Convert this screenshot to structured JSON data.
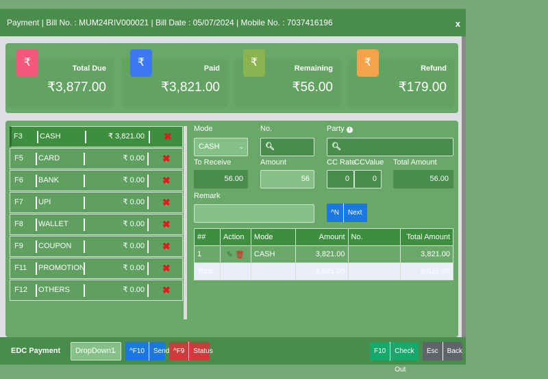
{
  "header": {
    "title": "Payment | Bill No. : MUM24RIV000021 | Bill Date : 05/07/2024 | Mobile No. : 7037416196",
    "close": "x"
  },
  "summary": [
    {
      "label": "Total Due",
      "value": "₹3,877.00",
      "icon": "rupee-icon",
      "color": "#f4587a"
    },
    {
      "label": "Paid",
      "value": "₹3,821.00",
      "icon": "rupee-icon",
      "color": "#3c78f0"
    },
    {
      "label": "Remaining",
      "value": "₹56.00",
      "icon": "rupee-icon",
      "color": "#8ab24e"
    },
    {
      "label": "Refund",
      "value": "₹179.00",
      "icon": "rupee-icon",
      "color": "#f5a34a"
    }
  ],
  "modes": [
    {
      "key": "F3",
      "name": "CASH",
      "amount": "₹ 3,821.00",
      "active": true
    },
    {
      "key": "F5",
      "name": "CARD",
      "amount": "₹ 0.00"
    },
    {
      "key": "F6",
      "name": "BANK",
      "amount": "₹ 0.00"
    },
    {
      "key": "F7",
      "name": "UPI",
      "amount": "₹ 0.00"
    },
    {
      "key": "F8",
      "name": "WALLET",
      "amount": "₹ 0.00"
    },
    {
      "key": "F9",
      "name": "COUPON",
      "amount": "₹ 0.00"
    },
    {
      "key": "F11",
      "name": "PROMOTION",
      "amount": "₹ 0.00"
    },
    {
      "key": "F12",
      "name": "OTHERS",
      "amount": "₹ 0.00"
    }
  ],
  "form": {
    "mode_label": "Mode",
    "mode_value": "CASH",
    "no_label": "No.",
    "party_label": "Party",
    "to_receive_label": "To Receive",
    "to_receive": "56.00",
    "amount_label": "Amount",
    "amount": "56",
    "cc_rate_label": "CC Rate",
    "cc_rate": "0",
    "cc_value_label": "CCValue",
    "cc_value": "0",
    "total_amount_label": "Total Amount",
    "total_amount": "56.00",
    "remark_label": "Remark",
    "remark": "",
    "next_key": "^N",
    "next_label": "Next"
  },
  "table": {
    "headers": [
      "##",
      "Action",
      "Mode",
      "Amount",
      "No.",
      "Total Amount"
    ],
    "rows": [
      {
        "n": "1",
        "mode": "CASH",
        "amount": "3,821.00",
        "no": "",
        "total": "3,821.00"
      }
    ],
    "total": {
      "label": "Total",
      "amount": "3,821.00",
      "total": "3,821.00"
    }
  },
  "footer": {
    "edc_label": "EDC Payment",
    "dropdown": "DropDown1",
    "send_key": "^F10",
    "send": "Send",
    "status_key": "^F9",
    "status": "Status",
    "checkout_key": "F10",
    "checkout": "Check Out",
    "back_key": "Esc",
    "back": "Back"
  }
}
